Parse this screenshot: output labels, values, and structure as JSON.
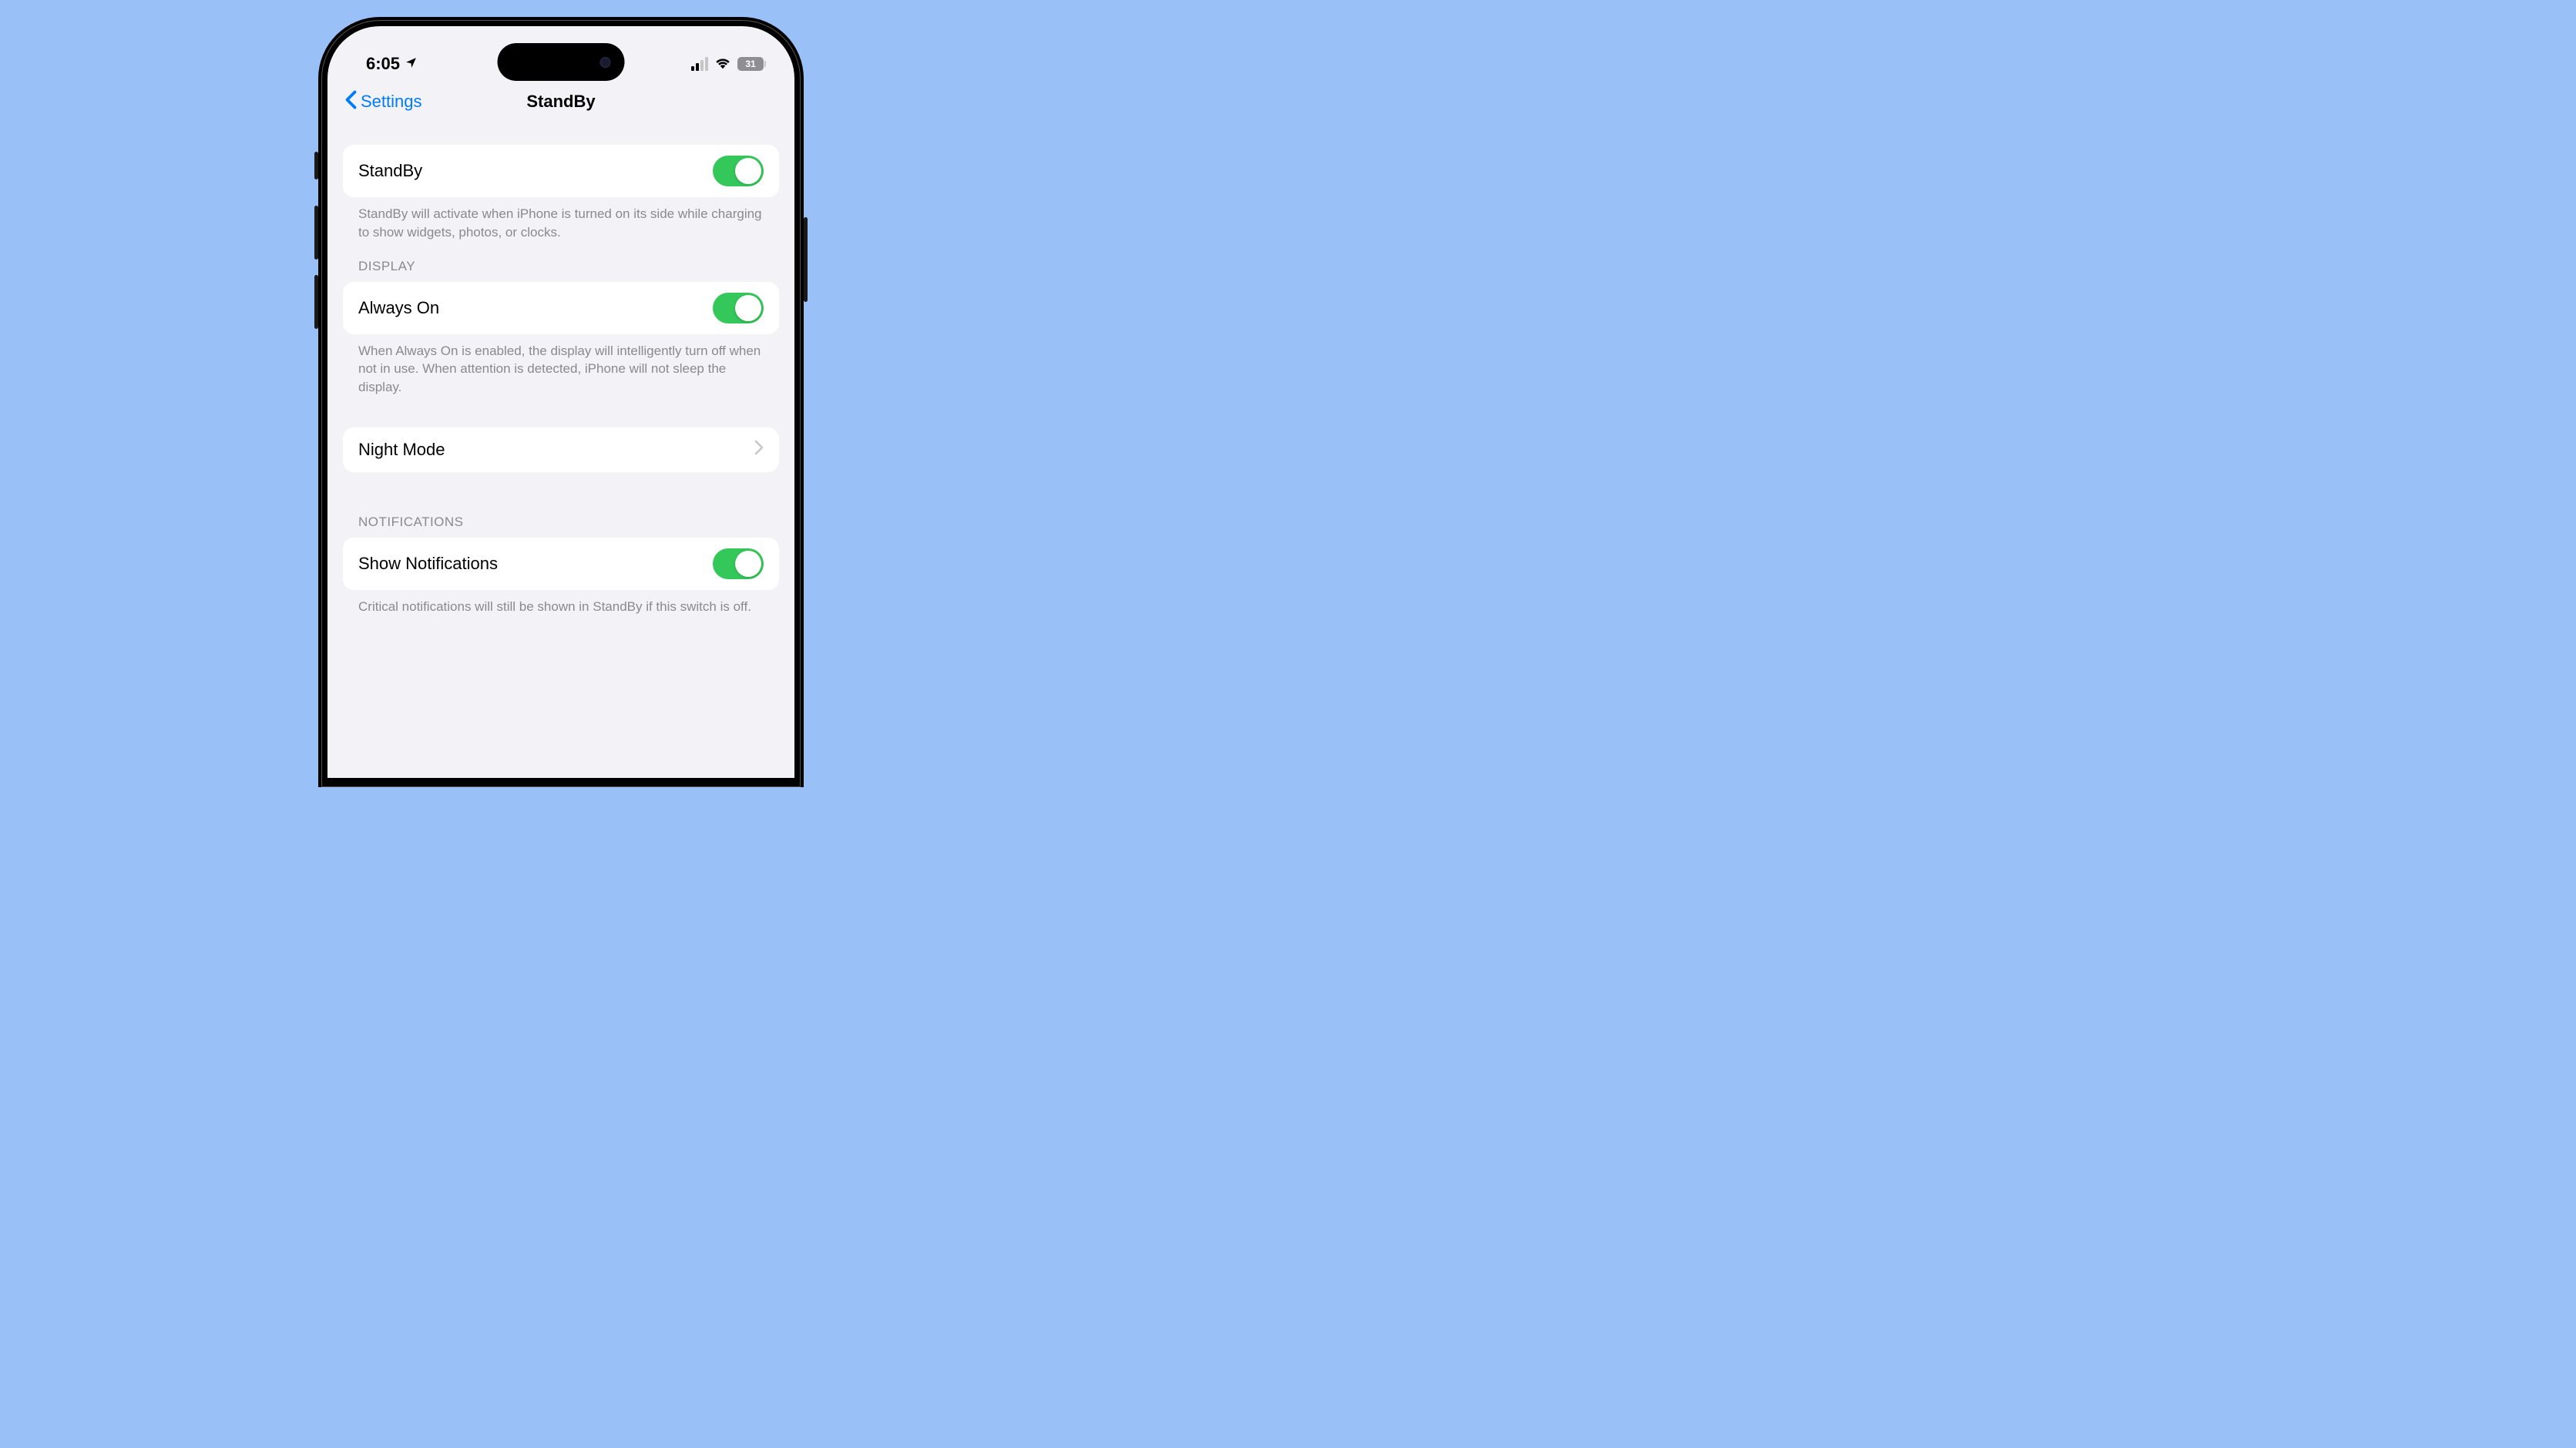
{
  "status_bar": {
    "time": "6:05",
    "battery_level": "31"
  },
  "nav": {
    "back_label": "Settings",
    "title": "StandBy"
  },
  "sections": {
    "standby": {
      "row_label": "StandBy",
      "footer": "StandBy will activate when iPhone is turned on its side while charging to show widgets, photos, or clocks."
    },
    "display": {
      "header": "DISPLAY",
      "always_on_label": "Always On",
      "always_on_footer": "When Always On is enabled, the display will intelligently turn off when not in use. When attention is detected, iPhone will not sleep the display.",
      "night_mode_label": "Night Mode"
    },
    "notifications": {
      "header": "NOTIFICATIONS",
      "show_label": "Show Notifications",
      "footer": "Critical notifications will still be shown in StandBy if this switch is off."
    }
  }
}
